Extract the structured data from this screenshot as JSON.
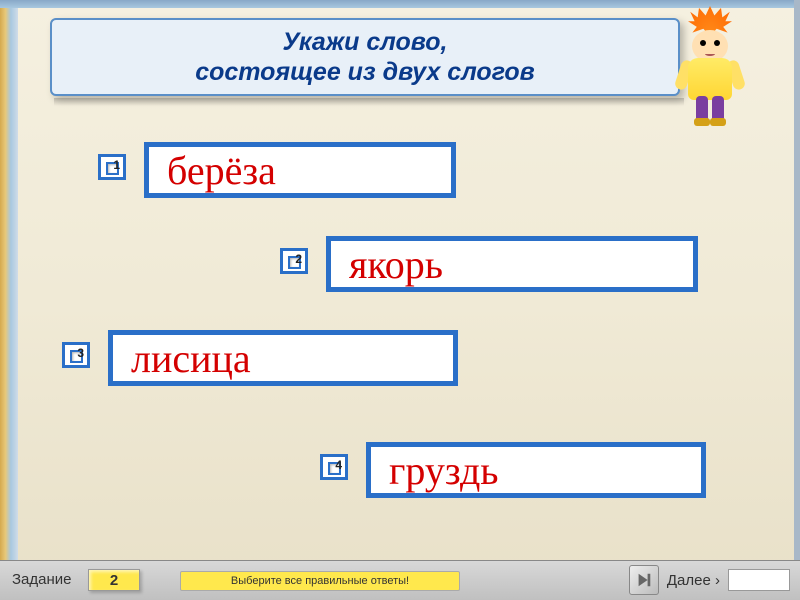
{
  "title": {
    "line1": "Укажи слово,",
    "line2": "состоящее из двух слогов"
  },
  "options": [
    {
      "num": "1",
      "word": "берёза"
    },
    {
      "num": "2",
      "word": "якорь"
    },
    {
      "num": "3",
      "word": "лисица"
    },
    {
      "num": "4",
      "word": "груздь"
    }
  ],
  "footer": {
    "task_label": "Задание",
    "task_number": "2",
    "hint": "Выберите все правильные ответы!",
    "next_label": "Далее"
  },
  "colors": {
    "blue": "#2a6fc8",
    "red": "#d40000",
    "yellow": "#ffe84d"
  }
}
